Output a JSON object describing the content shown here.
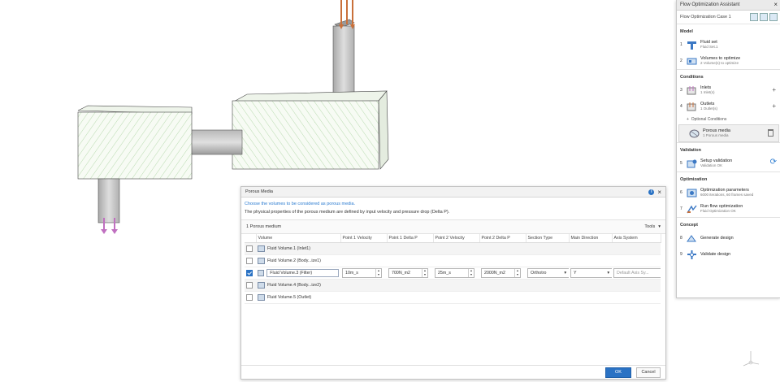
{
  "panel": {
    "title": "Flow Optimization Assistant",
    "case": "Flow Optimization Case 1",
    "sections": {
      "model": "Model",
      "conditions": "Conditions",
      "validation": "Validation",
      "optimization": "Optimization",
      "concept": "Concept"
    },
    "steps": {
      "fluid_set": {
        "num": "1",
        "label": "Fluid set",
        "sub": "Fluid Set.1"
      },
      "volumes": {
        "num": "2",
        "label": "Volumes to optimize",
        "sub": "2 Volume(s) to optimize"
      },
      "inlets": {
        "num": "3",
        "label": "Inlets",
        "sub": "1 Inlet(s)"
      },
      "outlets": {
        "num": "4",
        "label": "Outlets",
        "sub": "1 Outlet(s)"
      },
      "optional": "Optional Conditions",
      "porous": {
        "label": "Porous media",
        "sub": "1 Porous media"
      },
      "setup_validation": {
        "num": "5",
        "label": "Setup validation",
        "sub": "Validation OK"
      },
      "opt_params": {
        "num": "6",
        "label": "Optimization parameters",
        "sub": "6000 iterations, 60 frames saved"
      },
      "run_opt": {
        "num": "7",
        "label": "Run flow optimization",
        "sub": "Fluid Optimization OK"
      },
      "generate": {
        "num": "8",
        "label": "Generate design"
      },
      "validate": {
        "num": "9",
        "label": "Validate design"
      }
    }
  },
  "dialog": {
    "title": "Porous Media",
    "instruction": "Choose the volumes to be considered as porous media.",
    "description": "The physical properties of the porous medium are defined by input velocity and pressure drop (Delta P).",
    "section_label": "1  Porous medium",
    "tools_label": "Tools",
    "columns": [
      "Volume",
      "Point 1 Velocity",
      "Point 1 Delta P",
      "Point 2 Velocity",
      "Point 2 Delta P",
      "Section Type",
      "Main Direction",
      "Axis System"
    ],
    "rows": [
      {
        "name": "Fluid Volume.1  (Inlet1)",
        "checked": false
      },
      {
        "name": "Fluid Volume.2  (Body...ize1)",
        "checked": false
      },
      {
        "name": "Fluid Volume.3  (Filter)",
        "checked": true,
        "p1v": "10m_s",
        "p1dp": "700N_m2",
        "p2v": "25m_s",
        "p2dp": "2000N_m2",
        "section": "Orthotro",
        "direction": "Y",
        "axis_placeholder": "Default Axis Sy..."
      },
      {
        "name": "Fluid Volume.4  (Body...ize2)",
        "checked": false
      },
      {
        "name": "Fluid Volume.5  (Outlet)",
        "checked": false
      }
    ],
    "ok": "OK",
    "cancel": "Cancel"
  }
}
